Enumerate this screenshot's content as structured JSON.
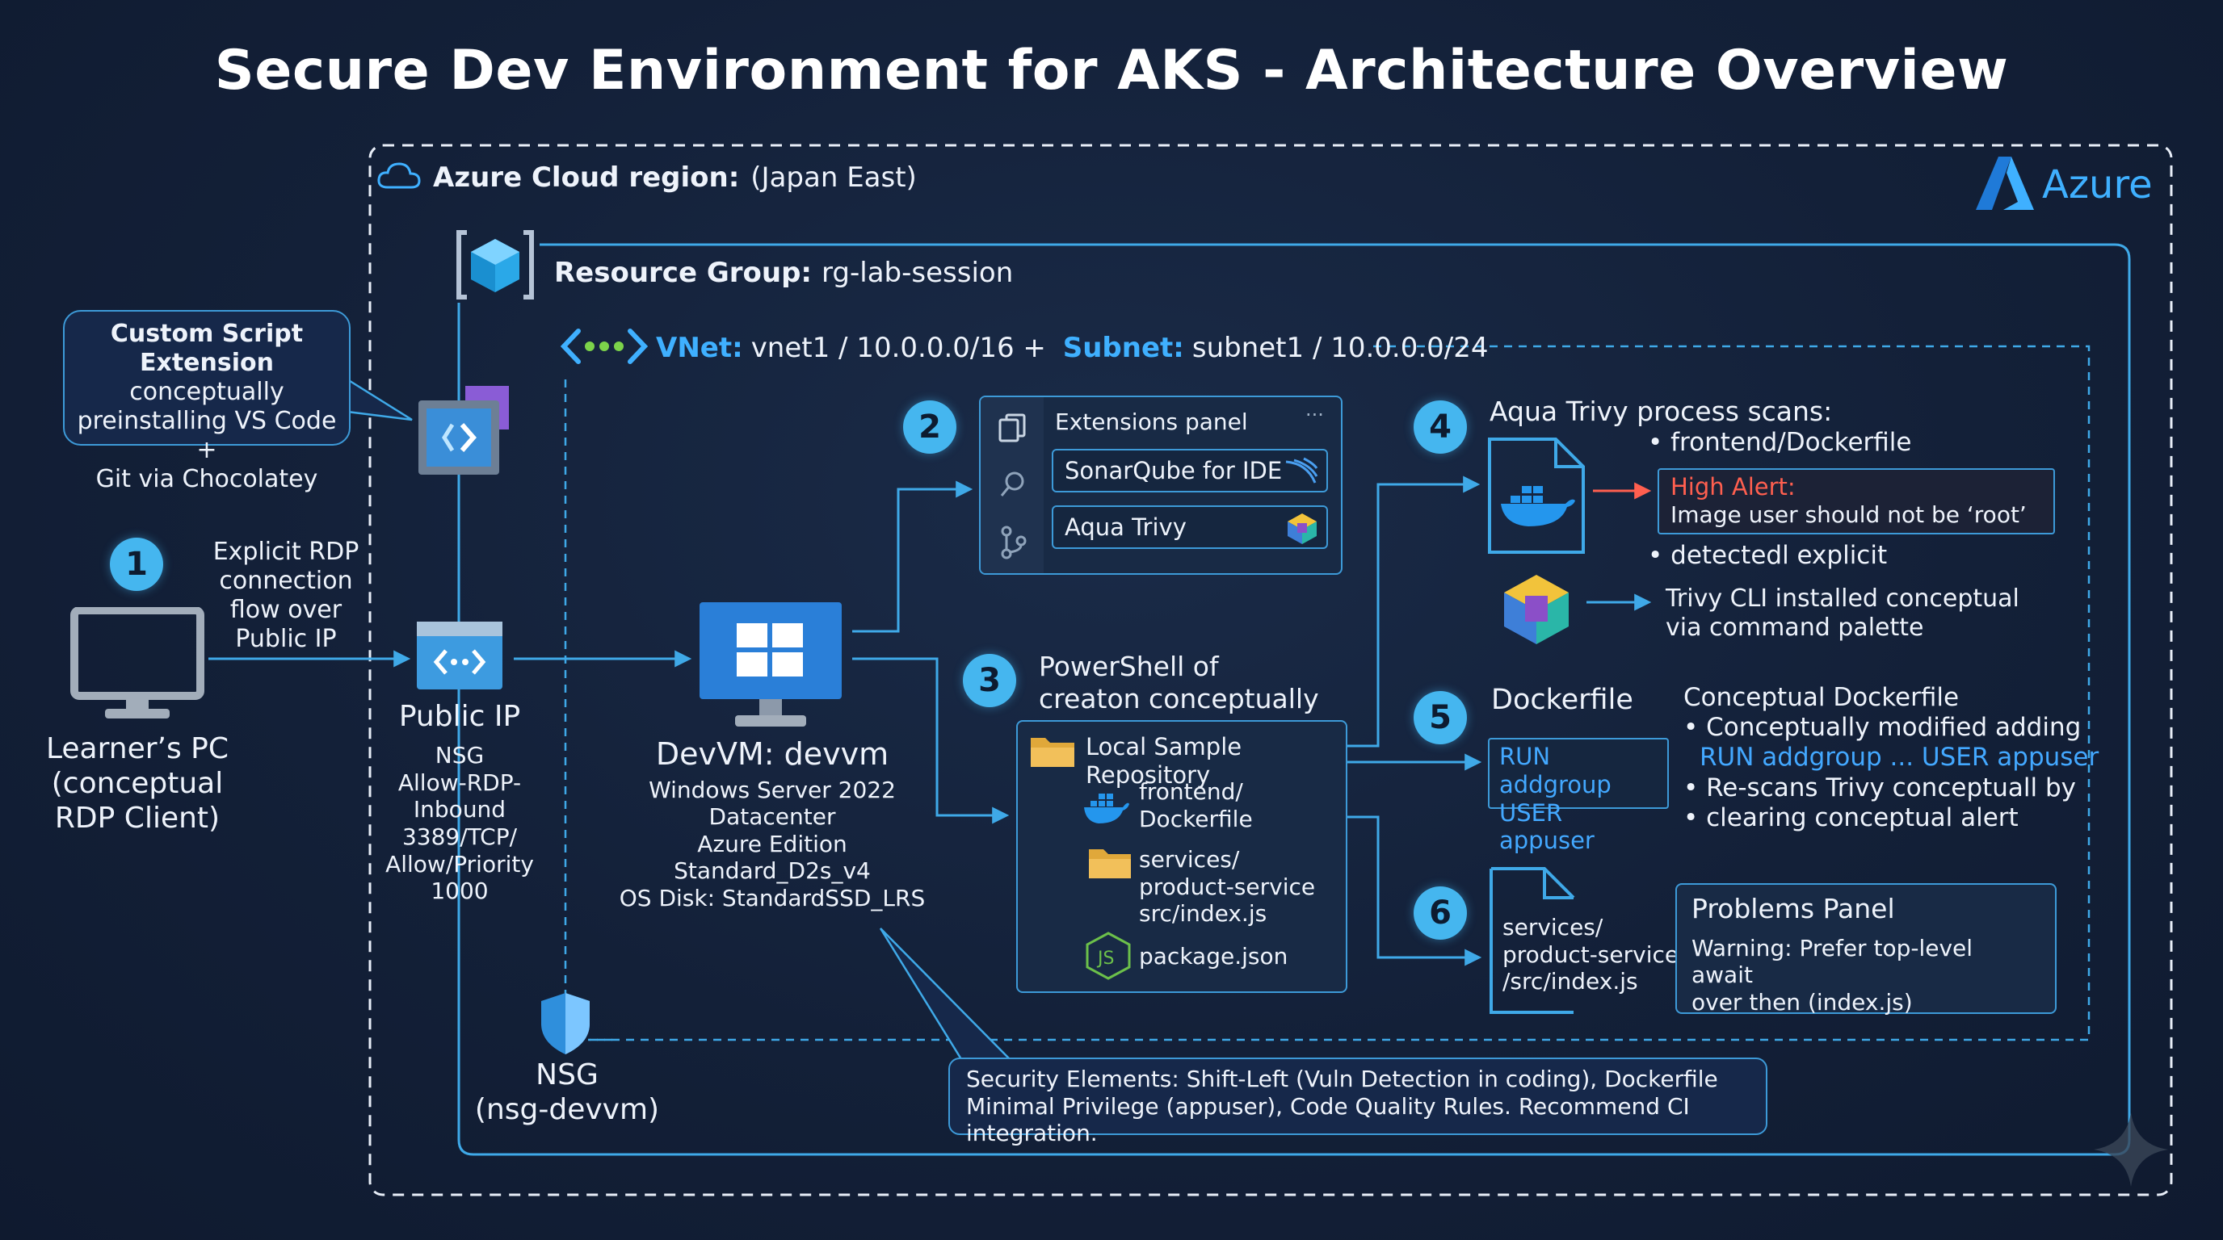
{
  "title": "Secure Dev Environment for AKS - Architecture Overview",
  "region": {
    "label": "Azure Cloud region:",
    "value": "(Japan East)",
    "brand": "Azure"
  },
  "resource_group": {
    "label": "Resource Group:",
    "value": "rg-lab-session"
  },
  "vnet": {
    "vnet_label": "VNet:",
    "vnet_value": "vnet1 / 10.0.0.0/16 + ",
    "subnet_label": "Subnet:",
    "subnet_value": "subnet1 / 10.0.0.0/24"
  },
  "cse_callout": {
    "line1": "Custom Script",
    "line2_bold": "Extension",
    "line2_rest": " conceptually",
    "line3": "preinstalling VS Code +",
    "line4": "Git via Chocolatey"
  },
  "learner": {
    "step": "1",
    "lines": [
      "Learner’s PC",
      "(conceptual",
      "RDP Client)"
    ]
  },
  "rdp_flow": {
    "lines": [
      "Explicit RDP",
      "connection",
      "flow over",
      "Public IP"
    ]
  },
  "public_ip": {
    "title": "Public IP",
    "lines": [
      "NSG",
      "Allow-RDP-",
      "Inbound 3389/TCP/",
      "Allow/Priority",
      "1000"
    ]
  },
  "nsg": {
    "lines": [
      "NSG",
      "(nsg-devvm)"
    ]
  },
  "devvm": {
    "title": "DevVM: devvm",
    "lines": [
      "Windows Server 2022",
      "Datacenter",
      "Azure Edition",
      "Standard_D2s_v4",
      "OS Disk: StandardSSD_LRS"
    ]
  },
  "extensions": {
    "step": "2",
    "title": "Extensions panel",
    "more": "···",
    "items": [
      "SonarQube for IDE",
      "Aqua Trivy"
    ]
  },
  "powershell": {
    "step": "3",
    "lines": [
      "PowerShell of",
      "creaton conceptually"
    ]
  },
  "repo": {
    "title": "Local Sample Repository",
    "frontend": [
      "frontend/",
      "Dockerfile"
    ],
    "services": [
      "services/",
      "product-service",
      "src/index.js"
    ],
    "package": "package.json"
  },
  "trivy": {
    "step": "4",
    "title": "Aqua Trivy process scans:",
    "bullet1": "• frontend/Dockerfile",
    "alert_title": "High Alert:",
    "alert_text": "Image user should not be ‘root’",
    "bullet2": "• detectedl explicit",
    "cli_lines": [
      "Trivy CLI installed conceptual",
      "via command palette"
    ]
  },
  "dockerfile": {
    "step": "5",
    "title": "Dockerfile",
    "run_lines": [
      "RUN addgroup",
      "USER appuser"
    ],
    "conceptual_title": "Conceptual Dockerfile",
    "b1": "• Conceptually modified adding",
    "b1_code": "RUN addgroup ... USER appuser",
    "b2": "• Re-scans Trivy conceptuall by",
    "b3": "• clearing conceptual alert"
  },
  "problems": {
    "step": "6",
    "file_lines": [
      "services/",
      "product-service",
      "/src/index.js"
    ],
    "title": "Problems Panel",
    "lines": [
      "Warning: Prefer top-level await",
      "over then (index.js)"
    ]
  },
  "security": {
    "lines": [
      "Security Elements: Shift-Left (Vuln Detection in coding), Dockerfile",
      "Minimal Privilege (appuser), Code Quality Rules. Recommend CI integration."
    ]
  },
  "colors": {
    "background": "#14213a",
    "accent": "#45b6ef",
    "line": "#3fa9e8",
    "alert": "#ff5f4f"
  }
}
